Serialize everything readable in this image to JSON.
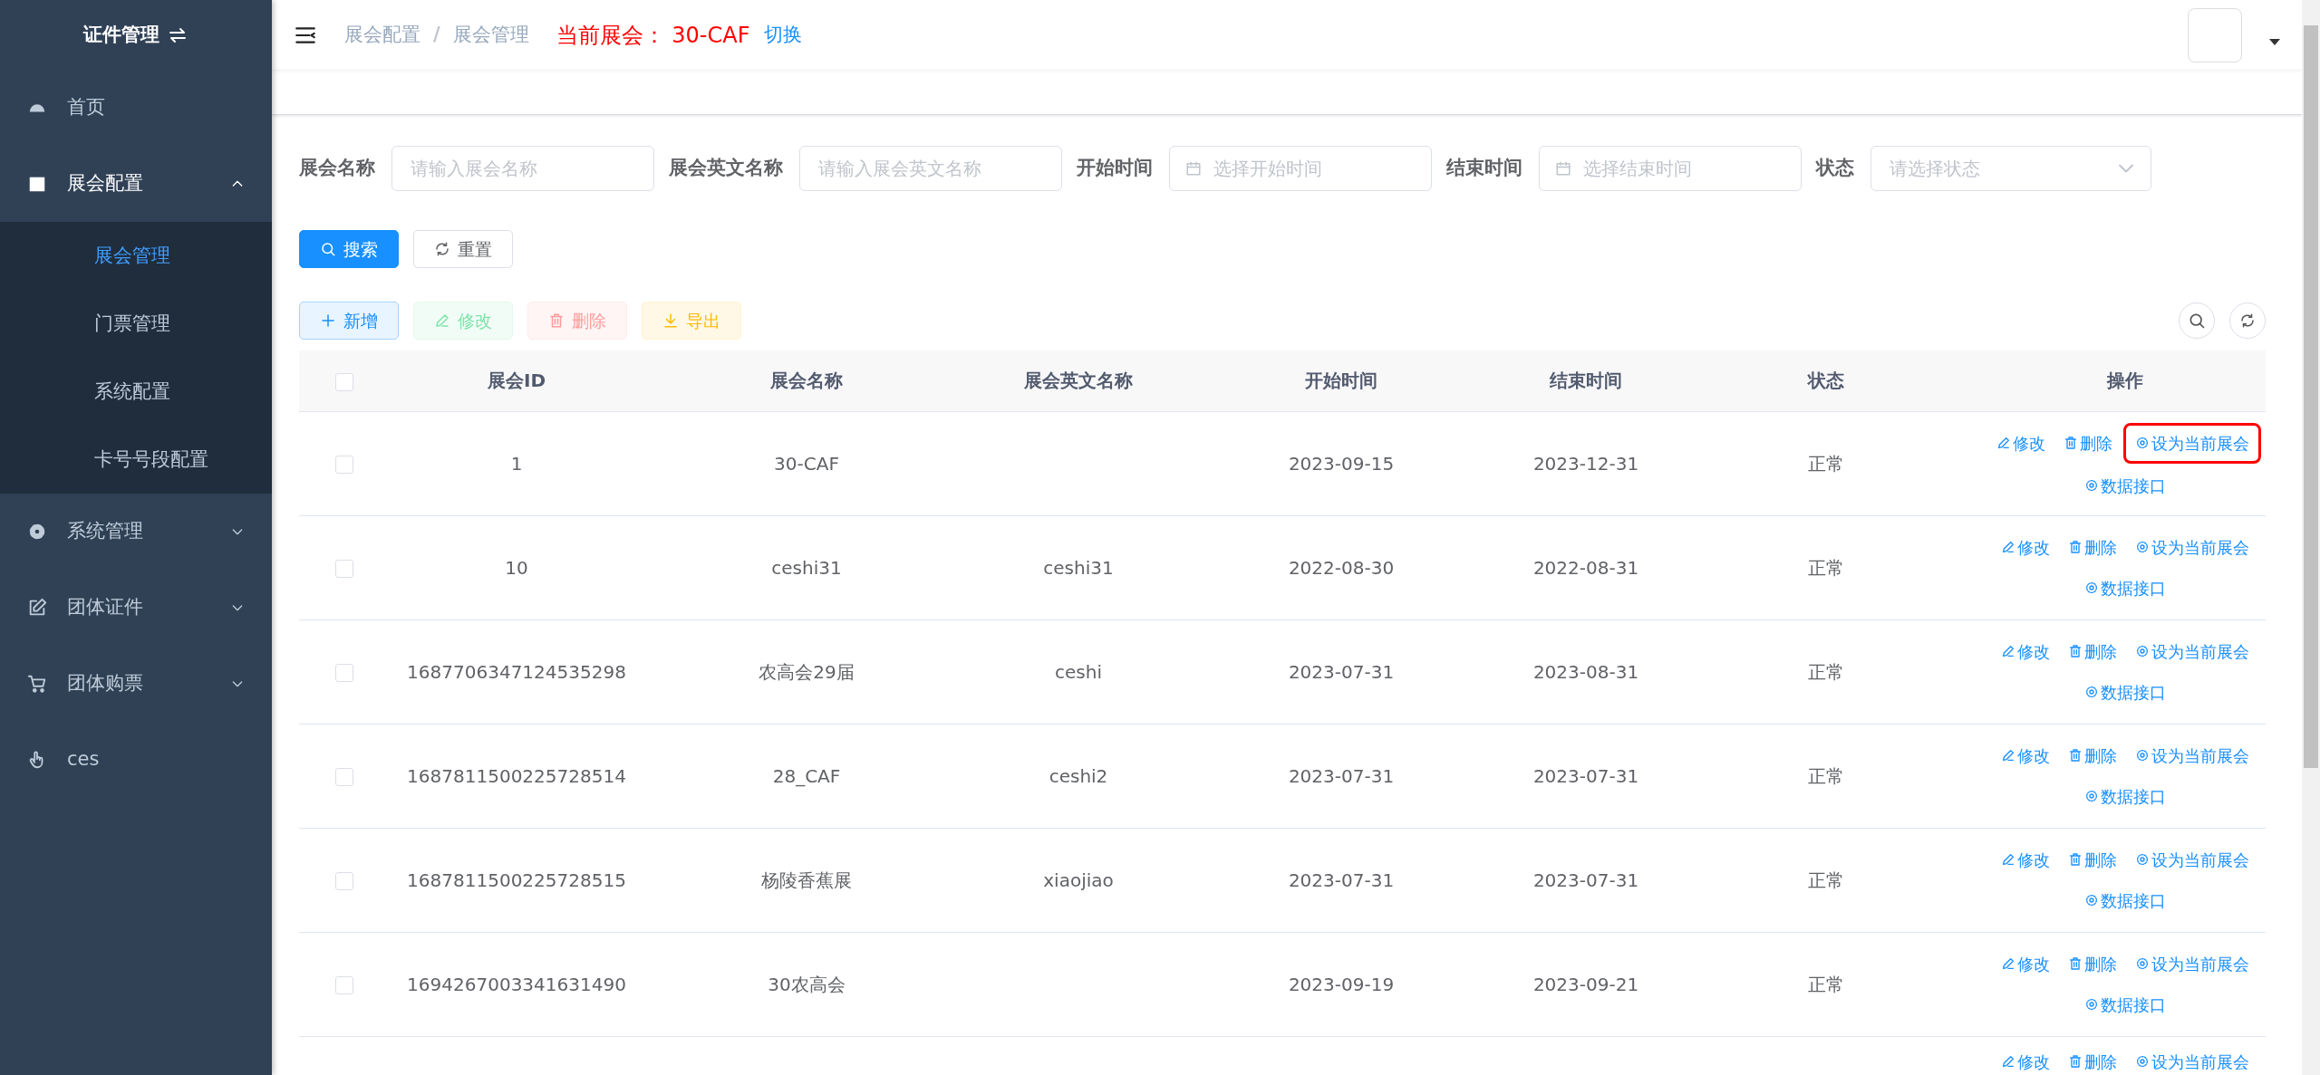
{
  "sidebar": {
    "title": "证件管理",
    "items": [
      {
        "label": "首页",
        "expandable": false,
        "expanded": false
      },
      {
        "label": "展会配置",
        "expandable": true,
        "expanded": true,
        "children": [
          {
            "label": "展会管理",
            "selected": true
          },
          {
            "label": "门票管理",
            "selected": false
          },
          {
            "label": "系统配置",
            "selected": false
          },
          {
            "label": "卡号号段配置",
            "selected": false
          }
        ]
      },
      {
        "label": "系统管理",
        "expandable": true,
        "expanded": false
      },
      {
        "label": "团体证件",
        "expandable": true,
        "expanded": false
      },
      {
        "label": "团体购票",
        "expandable": true,
        "expanded": false
      },
      {
        "label": "ces",
        "expandable": false,
        "expanded": false
      }
    ]
  },
  "header": {
    "breadcrumb": [
      "展会配置",
      "展会管理"
    ],
    "breadcrumb_separator": "/",
    "current_label": "当前展会：",
    "current_value": "30-CAF",
    "switch_link": "切换"
  },
  "filters": [
    {
      "label": "展会名称",
      "kind": "text",
      "placeholder": "请输入展会名称"
    },
    {
      "label": "展会英文名称",
      "kind": "text",
      "placeholder": "请输入展会英文名称"
    },
    {
      "label": "开始时间",
      "kind": "date",
      "placeholder": "选择开始时间"
    },
    {
      "label": "结束时间",
      "kind": "date",
      "placeholder": "选择结束时间"
    },
    {
      "label": "状态",
      "kind": "select",
      "placeholder": "请选择状态"
    }
  ],
  "search_buttons": [
    {
      "label": "搜索",
      "kind": "search"
    },
    {
      "label": "重置",
      "kind": "reset"
    }
  ],
  "toolbar": [
    {
      "label": "新增",
      "kind": "add",
      "disabled": false
    },
    {
      "label": "修改",
      "kind": "edit",
      "disabled": true
    },
    {
      "label": "删除",
      "kind": "delete",
      "disabled": true
    },
    {
      "label": "导出",
      "kind": "export",
      "disabled": false
    }
  ],
  "table": {
    "select_all_checked": false,
    "columns": [
      "展会ID",
      "展会名称",
      "展会英文名称",
      "开始时间",
      "结束时间",
      "状态",
      "操作"
    ],
    "rows": [
      {
        "cells": [
          "1",
          "30-CAF",
          null,
          "2023-09-15",
          "2023-12-31",
          "正常"
        ],
        "checked": false,
        "highlighted": true,
        "actions": [
          "修改",
          "删除",
          "设为当前展会",
          "数据接口"
        ]
      },
      {
        "cells": [
          "10",
          "ceshi31",
          "ceshi31",
          "2022-08-30",
          "2022-08-31",
          "正常"
        ],
        "checked": false,
        "highlighted": false,
        "actions": [
          "修改",
          "删除",
          "设为当前展会",
          "数据接口"
        ]
      },
      {
        "cells": [
          "1687706347124535298",
          "农高会29届",
          "ceshi",
          "2023-07-31",
          "2023-08-31",
          "正常"
        ],
        "checked": false,
        "highlighted": false,
        "actions": [
          "修改",
          "删除",
          "设为当前展会",
          "数据接口"
        ]
      },
      {
        "cells": [
          "1687811500225728514",
          "28_CAF",
          "ceshi2",
          "2023-07-31",
          "2023-07-31",
          "正常"
        ],
        "checked": false,
        "highlighted": false,
        "actions": [
          "修改",
          "删除",
          "设为当前展会",
          "数据接口"
        ]
      },
      {
        "cells": [
          "1687811500225728515",
          "杨陵香蕉展",
          "xiaojiao",
          "2023-07-31",
          "2023-07-31",
          "正常"
        ],
        "checked": false,
        "highlighted": false,
        "actions": [
          "修改",
          "删除",
          "设为当前展会",
          "数据接口"
        ]
      },
      {
        "cells": [
          "1694267003341631490",
          "30农高会",
          null,
          "2023-09-19",
          "2023-09-21",
          "正常"
        ],
        "checked": false,
        "highlighted": false,
        "actions": [
          "修改",
          "删除",
          "设为当前展会",
          "数据接口"
        ]
      }
    ],
    "partial_row": {
      "actions": [
        "修改",
        "删除",
        "设为当前展会"
      ]
    }
  }
}
